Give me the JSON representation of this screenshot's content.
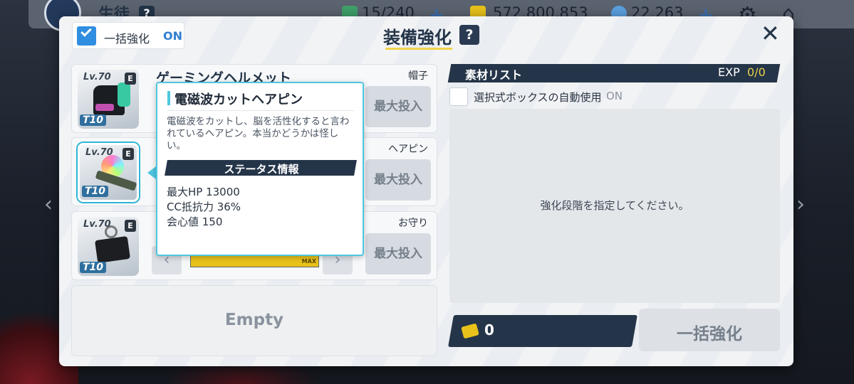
{
  "header": {
    "title": "生徒",
    "help": "?",
    "stamina": "15/240",
    "credits": "572,800,853",
    "gems": "22,263",
    "plus": "+"
  },
  "modal": {
    "title": "装備強化",
    "help": "?",
    "close": "✕",
    "bulk_label": "一括強化",
    "bulk_state": "ON"
  },
  "equipment": [
    {
      "level": "Lv.70",
      "rarity": "E",
      "tier": "T10",
      "name": "ゲーミングヘルメット",
      "type": "帽子",
      "max_label": "最大投入"
    },
    {
      "level": "Lv.70",
      "rarity": "E",
      "tier": "T10",
      "name": "電磁波カットヘアピン",
      "type": "ヘアピン",
      "max_label": "最大投入"
    },
    {
      "level": "Lv.70",
      "rarity": "E",
      "tier": "T10",
      "name": "",
      "type": "お守り",
      "max_label": "最大投入",
      "exp_label": "MAX"
    }
  ],
  "empty_slot": "Empty",
  "tooltip": {
    "title": "電磁波カットヘアピン",
    "description": "電磁波をカットし、脳を活性化すると言われているヘアピン。本当かどうかは怪しい。",
    "stats_header": "ステータス情報",
    "stats": [
      "最大HP 13000",
      "CC抵抗力 36%",
      "会心値 150"
    ]
  },
  "materials": {
    "title": "素材リスト",
    "exp_label": "EXP",
    "exp_value": "0/0",
    "auto_label": "選択式ボックスの自動使用",
    "auto_state": "ON",
    "message": "強化段階を指定してください。",
    "cost": "0",
    "enhance_label": "一括強化"
  },
  "colors": {
    "accent": "#4ec6e0",
    "navy": "#253549",
    "gold": "#e8c21a",
    "blue": "#2f8ee0"
  }
}
